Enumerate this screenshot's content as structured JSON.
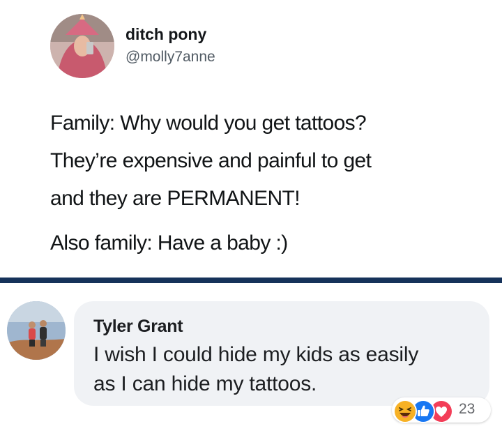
{
  "tweet": {
    "display_name": "ditch pony",
    "handle": "@molly7anne",
    "lines": [
      "Family: Why would you get tattoos?",
      "They’re expensive and painful to get",
      "and they are PERMANENT!",
      "Also family: Have a baby :)"
    ]
  },
  "comment": {
    "author": "Tyler Grant",
    "text_lines": [
      "I wish I could hide my kids as easily",
      "as I can hide my tattoos."
    ],
    "reactions": {
      "icons": [
        "haha-reaction-icon",
        "like-reaction-icon",
        "love-reaction-icon"
      ],
      "count": "23"
    }
  },
  "colors": {
    "separator": "#16325a",
    "bubble": "#f0f2f5",
    "like_blue": "#1877f2",
    "love_red": "#f33e58",
    "haha_yellow": "#f7b125"
  }
}
